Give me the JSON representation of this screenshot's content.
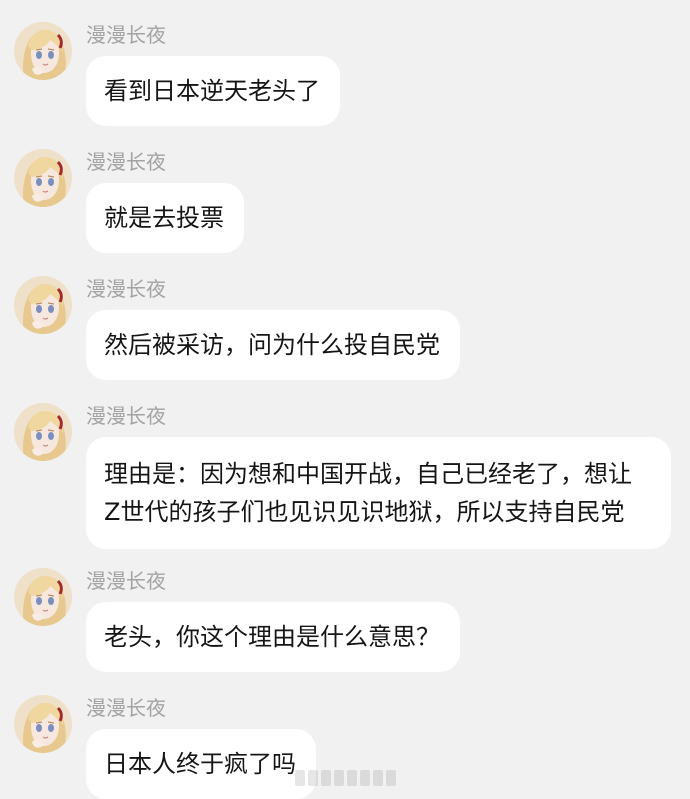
{
  "sender_name": "漫漫长夜",
  "messages": [
    {
      "sender": "漫漫长夜",
      "text": "看到日本逆天老头了"
    },
    {
      "sender": "漫漫长夜",
      "text": "就是去投票"
    },
    {
      "sender": "漫漫长夜",
      "text": "然后被采访，问为什么投自民党"
    },
    {
      "sender": "漫漫长夜",
      "lines": [
        "理由是：因为想和中国开战，自己已经老了，想让",
        "Z世代的孩子们也见识见识地狱，所以支持自民党"
      ]
    },
    {
      "sender": "漫漫长夜",
      "text": "老头，你这个理由是什么意思？"
    },
    {
      "sender": "漫漫长夜",
      "text": "日本人终于疯了吗"
    }
  ],
  "avatar": {
    "icon": "anime-girl-avatar-icon"
  },
  "colors": {
    "background": "#f1f1f1",
    "bubble": "#ffffff",
    "sender": "#a3a3a3",
    "text": "#151515"
  }
}
